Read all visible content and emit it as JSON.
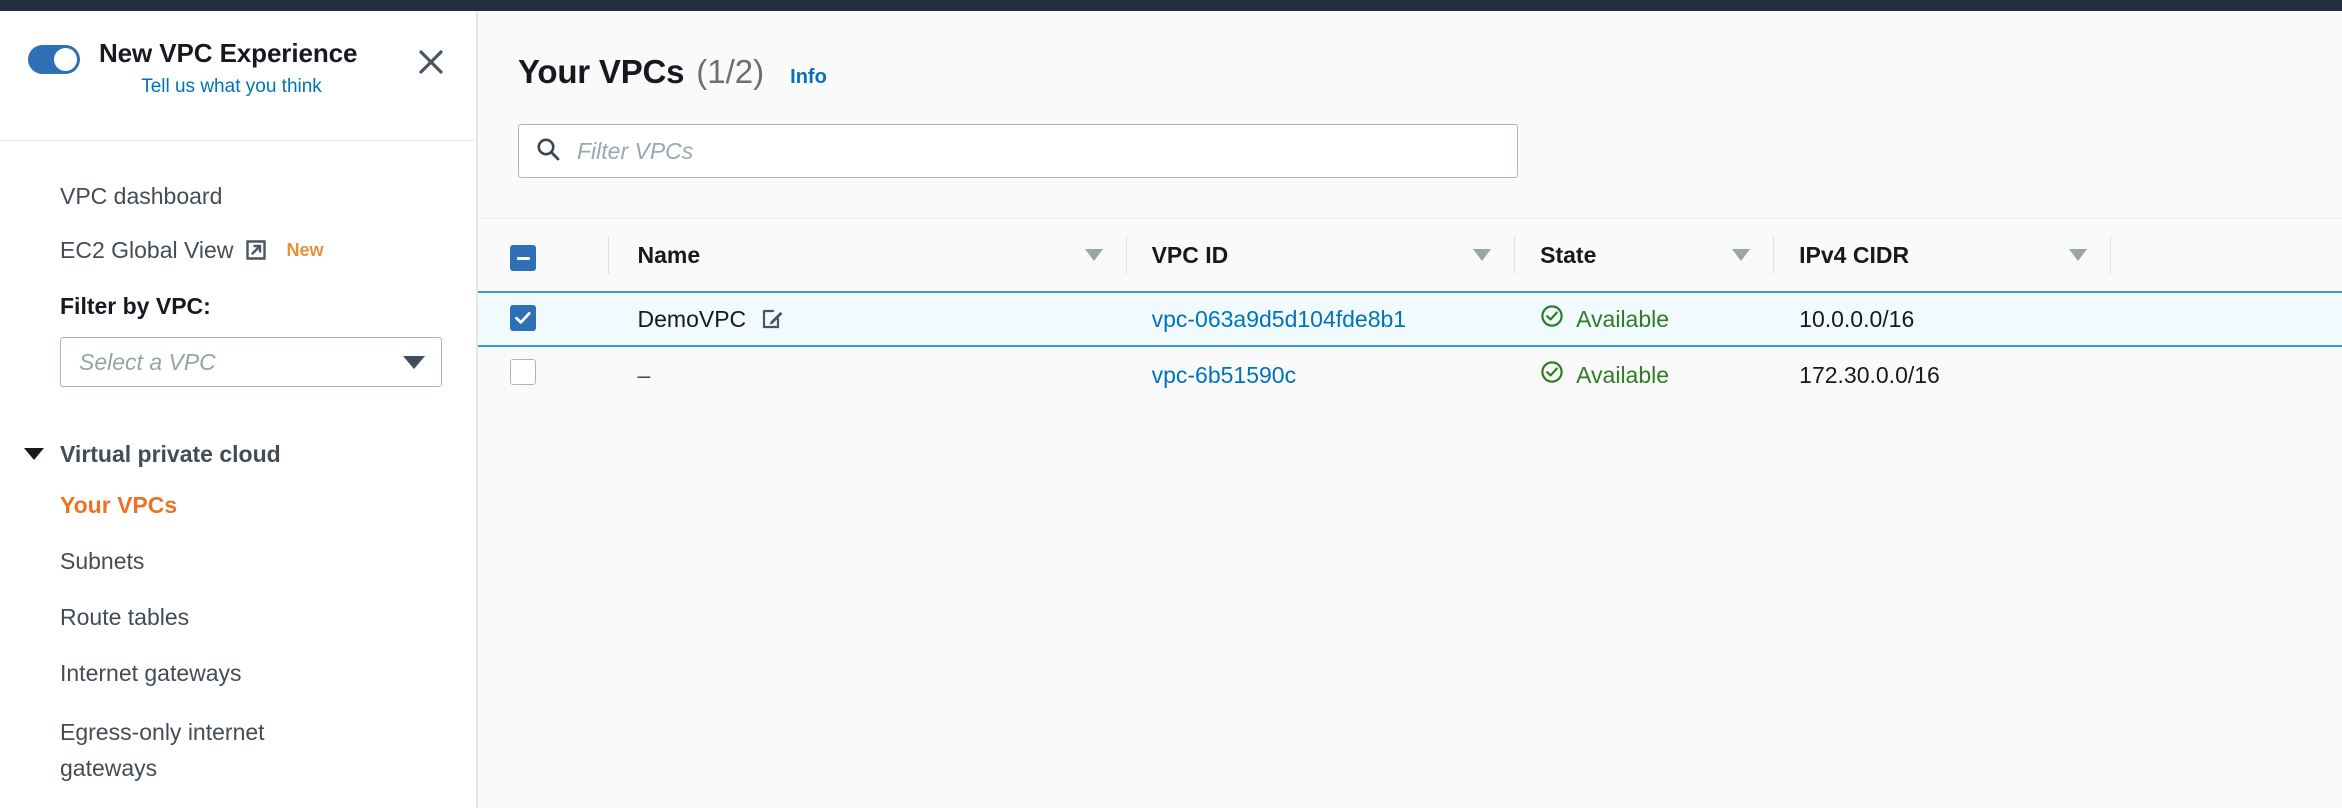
{
  "topbar": {
    "color": "#232f3e"
  },
  "sidebar": {
    "promo": {
      "toggle_state": "on",
      "title": "New VPC Experience",
      "feedback_link": "Tell us what you think",
      "close_icon": "close-icon"
    },
    "nav": [
      {
        "label": "VPC dashboard",
        "icon": null,
        "badge": null
      },
      {
        "label": "EC2 Global View",
        "icon": "external-link-icon",
        "badge": "New"
      }
    ],
    "filter": {
      "label": "Filter by VPC:",
      "placeholder": "Select a VPC",
      "value": ""
    },
    "group": {
      "label": "Virtual private cloud",
      "expanded": true,
      "items": [
        {
          "label": "Your VPCs",
          "active": true
        },
        {
          "label": "Subnets",
          "active": false
        },
        {
          "label": "Route tables",
          "active": false
        },
        {
          "label": "Internet gateways",
          "active": false
        },
        {
          "label": "Egress-only internet gateways",
          "active": false
        }
      ]
    }
  },
  "main": {
    "title": "Your VPCs",
    "count": "(1/2)",
    "info_label": "Info",
    "search": {
      "placeholder": "Filter VPCs",
      "value": "",
      "icon": "search-icon"
    },
    "table": {
      "header_checkbox_state": "indeterminate",
      "columns": [
        {
          "key": "name",
          "label": "Name",
          "sortable": true
        },
        {
          "key": "vpcid",
          "label": "VPC ID",
          "sortable": true
        },
        {
          "key": "state",
          "label": "State",
          "sortable": true
        },
        {
          "key": "cidr",
          "label": "IPv4 CIDR",
          "sortable": true
        }
      ],
      "rows": [
        {
          "selected": true,
          "name": "DemoVPC",
          "name_editable": true,
          "vpcid": "vpc-063a9d5d104fde8b1",
          "state": "Available",
          "state_icon": "check-circle-icon",
          "cidr": "10.0.0.0/16"
        },
        {
          "selected": false,
          "name": "–",
          "name_editable": false,
          "vpcid": "vpc-6b51590c",
          "state": "Available",
          "state_icon": "check-circle-icon",
          "cidr": "172.30.0.0/16"
        }
      ]
    }
  },
  "colors": {
    "accent_orange": "#eb7328",
    "link_blue": "#0073bb",
    "toggle_blue": "#2f6fb5",
    "status_green": "#2f7d20",
    "selected_row_bg": "#f1faff",
    "selected_row_border": "#3c9ac7",
    "topbar_navy": "#232f3e"
  }
}
